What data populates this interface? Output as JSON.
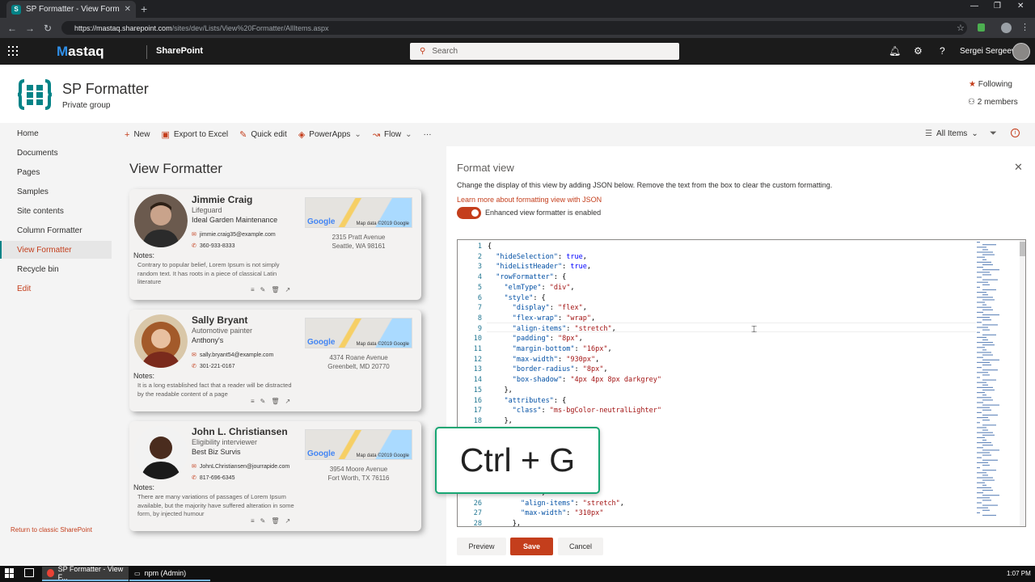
{
  "browser": {
    "tab_title": "SP Formatter - View Formatter -",
    "tab_favicon": "S",
    "url_host": "https://mastaq.sharepoint.com",
    "url_path": "/sites/dev/Lists/View%20Formatter/AllItems.aspx"
  },
  "suite": {
    "brand_m": "M",
    "brand_rest": "astaq",
    "app": "SharePoint",
    "search_placeholder": "Search",
    "user": "Sergei Sergeev"
  },
  "site": {
    "title": "SP Formatter",
    "subtitle": "Private group",
    "following": "Following",
    "members": "2 members"
  },
  "nav": {
    "items": [
      "Home",
      "Documents",
      "Pages",
      "Samples",
      "Site contents",
      "Column Formatter",
      "View Formatter",
      "Recycle bin",
      "Edit"
    ],
    "return_classic": "Return to classic SharePoint"
  },
  "commands": {
    "new": "New",
    "export": "Export to Excel",
    "quick_edit": "Quick edit",
    "powerapps": "PowerApps",
    "flow": "Flow",
    "more": "···",
    "view": "All Items"
  },
  "list_title": "View Formatter",
  "cards": [
    {
      "name": "Jimmie Craig",
      "job": "Lifeguard",
      "company": "Ideal Garden Maintenance",
      "email": "jimmie.craig35@example.com",
      "phone": "360-933-8333",
      "address1": "2315 Pratt Avenue",
      "address2": "Seattle, WA 98161",
      "notes_label": "Notes:",
      "notes": "Contrary to popular belief, Lorem Ipsum is not simply random text. It has roots in a piece of classical Latin literature"
    },
    {
      "name": "Sally Bryant",
      "job": "Automotive painter",
      "company": "Anthony's",
      "email": "sally.bryant54@example.com",
      "phone": "301-221-0167",
      "address1": "4374 Roane Avenue",
      "address2": "Greenbelt, MD 20770",
      "notes_label": "Notes:",
      "notes": "It is a long established fact that a reader will be distracted by the readable content of a page"
    },
    {
      "name": "John L. Christiansen",
      "job": "Eligibility interviewer",
      "company": "Best Biz Survis",
      "email": "JohnLChristiansen@jourrapide.com",
      "phone": "817-696-6345",
      "address1": "3954 Moore Avenue",
      "address2": "Fort Worth, TX 76116",
      "notes_label": "Notes:",
      "notes": "There are many variations of passages of Lorem Ipsum available, but the majority have suffered alteration in some form, by injected humour"
    }
  ],
  "map_label": "Google",
  "map_data": "Map data ©2019 Google",
  "panel": {
    "title": "Format view",
    "description": "Change the display of this view by adding JSON below. Remove the text from the box to clear the custom formatting.",
    "link": "Learn more about formatting view with JSON",
    "toggle_label": "Enhanced view formatter is enabled",
    "preview": "Preview",
    "save": "Save",
    "cancel": "Cancel"
  },
  "code_lines": [
    {
      "n": "1",
      "t": "{"
    },
    {
      "n": "2",
      "t": "  \"hideSelection\": true,"
    },
    {
      "n": "3",
      "t": "  \"hideListHeader\": true,"
    },
    {
      "n": "4",
      "t": "  \"rowFormatter\": {"
    },
    {
      "n": "5",
      "t": "    \"elmType\": \"div\","
    },
    {
      "n": "6",
      "t": "    \"style\": {"
    },
    {
      "n": "7",
      "t": "      \"display\": \"flex\","
    },
    {
      "n": "8",
      "t": "      \"flex-wrap\": \"wrap\","
    },
    {
      "n": "9",
      "t": "      \"align-items\": \"stretch\","
    },
    {
      "n": "10",
      "t": "      \"padding\": \"8px\","
    },
    {
      "n": "11",
      "t": "      \"margin-bottom\": \"16px\","
    },
    {
      "n": "12",
      "t": "      \"max-width\": \"930px\","
    },
    {
      "n": "13",
      "t": "      \"border-radius\": \"8px\","
    },
    {
      "n": "14",
      "t": "      \"box-shadow\": \"4px 4px 8px darkgrey\""
    },
    {
      "n": "15",
      "t": "    },"
    },
    {
      "n": "16",
      "t": "    \"attributes\": {"
    },
    {
      "n": "17",
      "t": "      \"class\": \"ms-bgColor-neutralLighter\""
    },
    {
      "n": "18",
      "t": "    },"
    },
    {
      "n": "",
      "t": ""
    },
    {
      "n": "",
      "t": ""
    },
    {
      "n": "",
      "t": ""
    },
    {
      "n": "",
      "t": ""
    },
    {
      "n": "",
      "t": ""
    },
    {
      "n": "",
      "t": "            ,"
    },
    {
      "n": "",
      "t": "            \","
    },
    {
      "n": "26",
      "t": "        \"align-items\": \"stretch\","
    },
    {
      "n": "27",
      "t": "        \"max-width\": \"310px\""
    },
    {
      "n": "28",
      "t": "      },"
    }
  ],
  "shortcut_overlay": "Ctrl + G",
  "taskbar": {
    "chrome": "SP Formatter - View F...",
    "npm": "npm (Admin)",
    "time": "1:07 PM"
  },
  "colors": {
    "accent": "#c43e1c",
    "teal": "#038387",
    "suite_bg": "#1b1b1b"
  }
}
